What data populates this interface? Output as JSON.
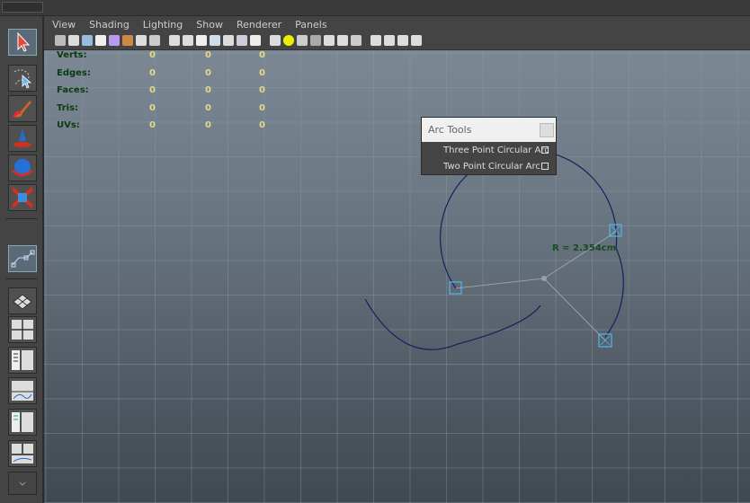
{
  "menu": [
    "View",
    "Shading",
    "Lighting",
    "Show",
    "Renderer",
    "Panels"
  ],
  "hud": {
    "rows": [
      {
        "label": "Verts:",
        "a": "0",
        "b": "0",
        "c": "0"
      },
      {
        "label": "Edges:",
        "a": "0",
        "b": "0",
        "c": "0"
      },
      {
        "label": "Faces:",
        "a": "0",
        "b": "0",
        "c": "0"
      },
      {
        "label": "Tris:",
        "a": "0",
        "b": "0",
        "c": "0"
      },
      {
        "label": "UVs:",
        "a": "0",
        "b": "0",
        "c": "0"
      }
    ]
  },
  "arc_tools": {
    "title": "Arc Tools",
    "items": [
      "Three Point Circular Arc",
      "Two Point Circular Arc"
    ]
  },
  "radius_label": "R = 2.354cm",
  "colors": {
    "arc": "#15205e",
    "handle": "#4fb8e8",
    "hud_label": "#0a3a10",
    "hud_value": "#e6d98a"
  }
}
